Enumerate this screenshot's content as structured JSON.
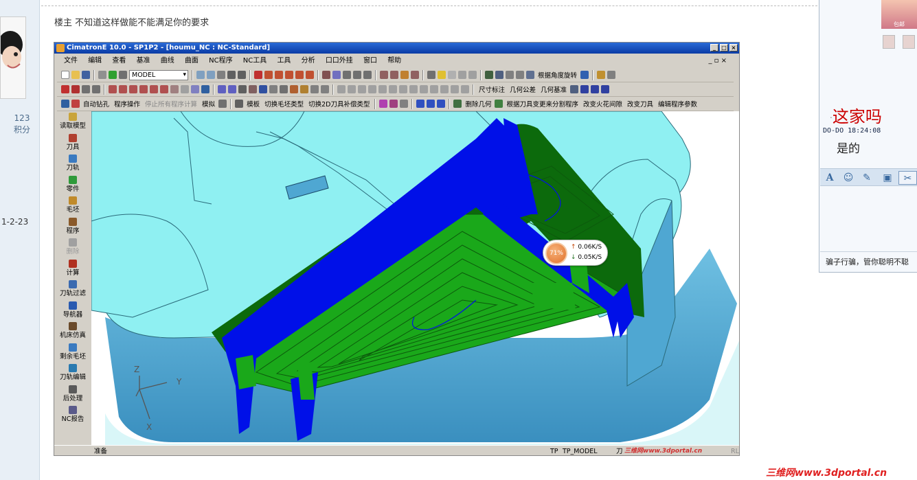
{
  "forum": {
    "points_value": "123",
    "points_label": "积分",
    "reg_date": "1-2-23",
    "post_text": "楼主 不知道这样做能不能满足你的要求"
  },
  "cad": {
    "title": "CimatronE 10.0 - SP1P2 - [houmu_NC : NC-Standard]",
    "menu": [
      "文件",
      "编辑",
      "查看",
      "基准",
      "曲线",
      "曲面",
      "NC程序",
      "NC工具",
      "工具",
      "分析",
      "口口外挂",
      "窗口",
      "帮助"
    ],
    "window_controls": [
      "_",
      "□",
      "×"
    ],
    "model_select": "MODEL",
    "toolbar1_labels": {
      "angle": "根据角度旋转"
    },
    "toolbar2_labels": {
      "dim": "尺寸标注",
      "geo_tol": "几何公差",
      "geo_ref": "几何基准"
    },
    "toolbar3_labels": {
      "auto_drill": "自动钻孔",
      "program_ops": "程序操作",
      "stop_calc": "停止所有程序计算",
      "simulate": "模拟",
      "template": "模板",
      "switch_blank": "切换毛坯类型",
      "switch_2d": "切换2D刀具补偿类型",
      "delete_geo": "删除几何",
      "split_by_tool": "根据刀具变更来分割程序",
      "change_spark": "改变火花间隙",
      "change_tool": "改变刀具",
      "edit_params": "编辑程序参数"
    },
    "sidebar": [
      {
        "label": "读取模型",
        "color": "#c9a43a"
      },
      {
        "label": "刀具",
        "color": "#b04030"
      },
      {
        "label": "刀轨",
        "color": "#3a7ac0"
      },
      {
        "label": "零件",
        "color": "#2f9a3a"
      },
      {
        "label": "毛坯",
        "color": "#c08a2a"
      },
      {
        "label": "程序",
        "color": "#8a5a2a"
      },
      {
        "label": "删除",
        "color": "#a0a0a0"
      },
      {
        "label": "计算",
        "color": "#b03020"
      },
      {
        "label": "刀轨过滤",
        "color": "#3a6ab0"
      },
      {
        "label": "导航器",
        "color": "#2a5ab0"
      },
      {
        "label": "机床仿真",
        "color": "#6a4a2a"
      },
      {
        "label": "剩余毛坯",
        "color": "#3a7ac0"
      },
      {
        "label": "刀轨编辑",
        "color": "#2a7ab0"
      },
      {
        "label": "后处理",
        "color": "#5a5a5a"
      },
      {
        "label": "NC报告",
        "color": "#5a5a8a"
      }
    ],
    "status_left": "准备",
    "status_tp": "TP",
    "status_model": "TP_MODEL",
    "status_knife": "刀",
    "status_watermark": "三维网www.3dportal.cn",
    "status_rl": "RL",
    "axis_labels": {
      "z": "Z",
      "y": "Y",
      "x": "X"
    },
    "speed": {
      "percent": "71%",
      "up": "0.06K/S",
      "down": "0.05K/S"
    }
  },
  "chat": {
    "avatar_caption": "包邮",
    "msg1": "这家吗",
    "meta": "DO-DO  18:24:08",
    "msg2": "是的",
    "footer": "骗子行骗，管你聪明不聪"
  },
  "watermark": "三维网www.3dportal.cn",
  "colors": {
    "cyan_surface": "#8ff0f2",
    "wall_blue": "#4fa7d2",
    "toolpath_blue": "#0010e8",
    "pocket_green": "#1aa81a",
    "dark_green": "#0c6a0c"
  }
}
